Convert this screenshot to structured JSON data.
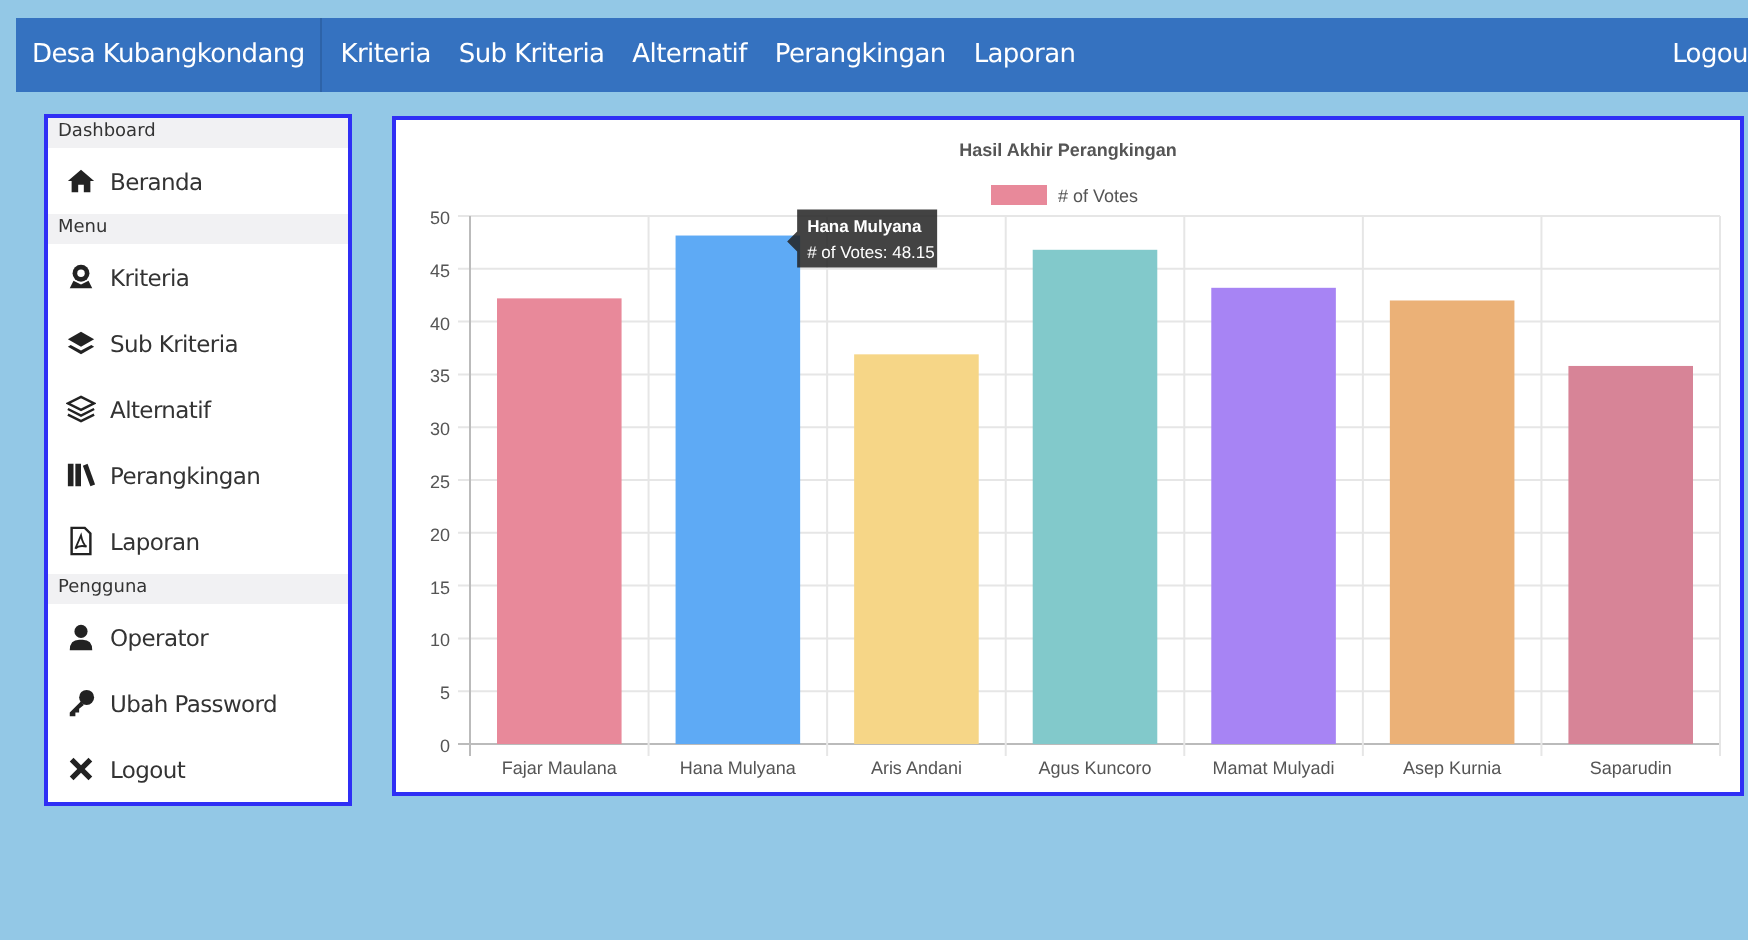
{
  "navbar": {
    "brand": "Desa Kubangkondang",
    "links": [
      "Kriteria",
      "Sub Kriteria",
      "Alternatif",
      "Perangkingan",
      "Laporan"
    ],
    "right_link": "Logou"
  },
  "sidebar": {
    "sections": [
      {
        "heading": "Dashboard",
        "items": [
          {
            "label": "Beranda"
          }
        ]
      },
      {
        "heading": "Menu",
        "items": [
          {
            "label": "Kriteria"
          },
          {
            "label": "Sub Kriteria"
          },
          {
            "label": "Alternatif"
          },
          {
            "label": "Perangkingan"
          },
          {
            "label": "Laporan"
          }
        ]
      },
      {
        "heading": "Pengguna",
        "items": [
          {
            "label": "Operator"
          },
          {
            "label": "Ubah Password"
          },
          {
            "label": "Logout"
          }
        ]
      }
    ]
  },
  "panel": {
    "chart_data": {
      "type": "bar",
      "title": "Hasil Akhir Perangkingan",
      "categories": [
        "Fajar Maulana",
        "Hana Mulyana",
        "Aris Andani",
        "Agus Kuncoro",
        "Mamat Mulyadi",
        "Asep Kurnia",
        "Saparudin"
      ],
      "series": [
        {
          "name": "# of Votes",
          "color": [
            "#e8899a",
            "#5eaaf5",
            "#f6d687",
            "#82c9cb",
            "#a784f4",
            "#ebb177",
            "#d78497"
          ],
          "values": [
            42.2,
            48.15,
            36.9,
            46.8,
            43.2,
            42.0,
            35.8
          ]
        }
      ],
      "ylim": [
        0,
        50
      ],
      "yticks": [
        0,
        5,
        10,
        15,
        20,
        25,
        30,
        35,
        40,
        45,
        50
      ],
      "grid": true
    },
    "tooltip": {
      "title": "Hana Mulyana",
      "text": "# of Votes: 48.15"
    }
  }
}
